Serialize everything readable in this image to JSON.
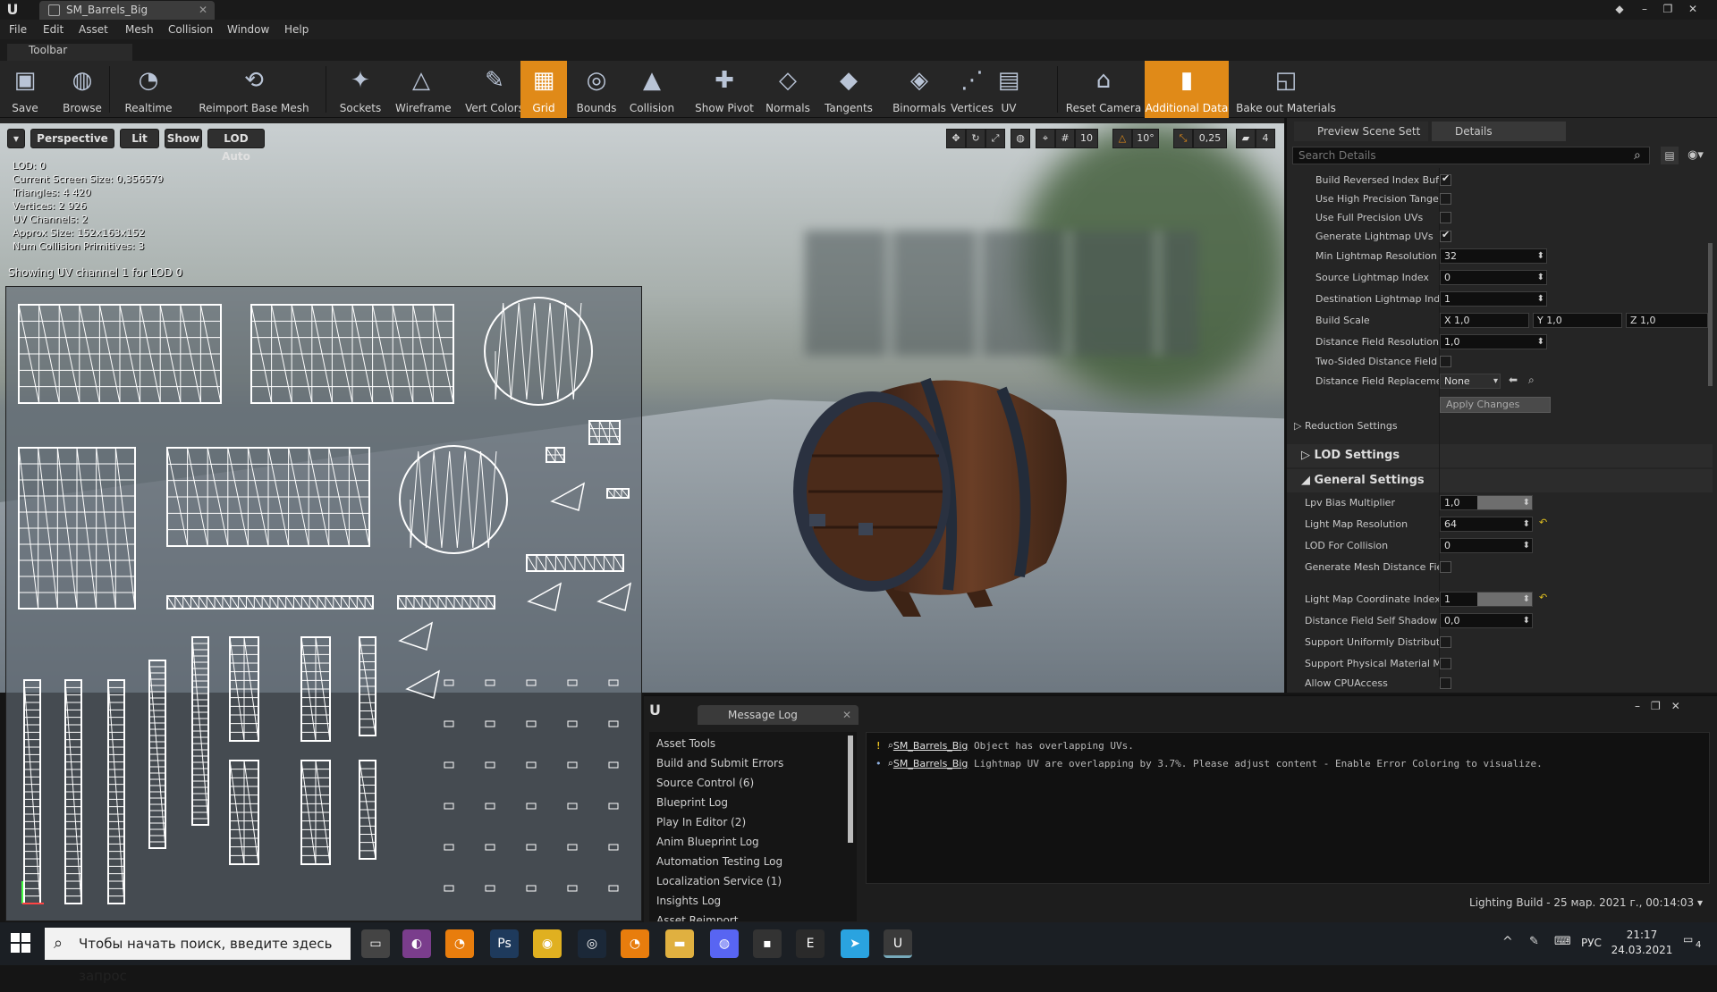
{
  "window": {
    "tab_title": "SM_Barrels_Big"
  },
  "menu": [
    "File",
    "Edit",
    "Asset",
    "Mesh",
    "Collision",
    "Window",
    "Help"
  ],
  "toolbar_panel_label": "Toolbar",
  "toolbar": [
    {
      "label": "Save",
      "icon": "save-icon"
    },
    {
      "label": "Browse",
      "icon": "browse-icon"
    },
    {
      "label": "Realtime",
      "icon": "realtime-icon"
    },
    {
      "label": "Reimport Base Mesh",
      "icon": "reimport-icon"
    },
    {
      "label": "Sockets",
      "icon": "sockets-icon"
    },
    {
      "label": "Wireframe",
      "icon": "wireframe-icon"
    },
    {
      "label": "Vert Colors",
      "icon": "vert-colors-icon"
    },
    {
      "label": "Grid",
      "icon": "grid-icon",
      "active": true
    },
    {
      "label": "Bounds",
      "icon": "bounds-icon"
    },
    {
      "label": "Collision",
      "icon": "collision-icon"
    },
    {
      "label": "Show Pivot",
      "icon": "pivot-icon"
    },
    {
      "label": "Normals",
      "icon": "normals-icon"
    },
    {
      "label": "Tangents",
      "icon": "tangents-icon"
    },
    {
      "label": "Binormals",
      "icon": "binormals-icon"
    },
    {
      "label": "Vertices",
      "icon": "vertices-icon"
    },
    {
      "label": "UV",
      "icon": "uv-icon"
    },
    {
      "label": "Reset Camera",
      "icon": "camera-icon"
    },
    {
      "label": "Additional Data",
      "icon": "additional-data-icon",
      "active": true
    },
    {
      "label": "Bake out Materials",
      "icon": "bake-icon"
    }
  ],
  "viewport": {
    "perspective": "Perspective",
    "lit": "Lit",
    "show": "Show",
    "lod": "LOD Auto",
    "grid_snap": "10",
    "rot_snap": "10°",
    "scale_snap": "0,25",
    "cam_speed": "4",
    "stats": [
      "LOD:  0",
      "Current Screen Size:  0,356579",
      "Triangles:  4 420",
      "Vertices:  2 926",
      "UV Channels:  2",
      "Approx Size: 152x163x152",
      "Num Collision Primitives:  3"
    ],
    "uv_caption": "Showing UV channel 1 for LOD 0"
  },
  "details": {
    "tab_preview": "Preview Scene Sett",
    "tab_details": "Details",
    "search_placeholder": "Search Details",
    "rows": [
      {
        "label": "Build Reversed Index Buffe",
        "type": "check",
        "value": true
      },
      {
        "label": "Use High Precision Tanger",
        "type": "check",
        "value": false
      },
      {
        "label": "Use Full Precision UVs",
        "type": "check",
        "value": false
      },
      {
        "label": "Generate Lightmap UVs",
        "type": "check",
        "value": true
      },
      {
        "label": "Min Lightmap Resolution",
        "type": "num",
        "value": "32"
      },
      {
        "label": "Source Lightmap Index",
        "type": "num",
        "value": "0"
      },
      {
        "label": "Destination Lightmap Inde",
        "type": "num",
        "value": "1"
      },
      {
        "label": "Build Scale",
        "type": "vec",
        "x": "1,0",
        "y": "1,0",
        "z": "1,0"
      },
      {
        "label": "Distance Field Resolution S",
        "type": "num",
        "value": "1,0"
      },
      {
        "label": "Two-Sided Distance Field",
        "type": "check",
        "value": false
      },
      {
        "label": "Distance Field Replacemer",
        "type": "combo",
        "value": "None"
      }
    ],
    "apply_changes": "Apply Changes",
    "reduction_settings": "Reduction Settings",
    "lod_settings": "LOD Settings",
    "general_settings": "General Settings",
    "general_rows": [
      {
        "label": "Lpv Bias Multiplier",
        "type": "slider",
        "value": "1,0"
      },
      {
        "label": "Light Map Resolution",
        "type": "num",
        "value": "64"
      },
      {
        "label": "LOD For Collision",
        "type": "num",
        "value": "0"
      },
      {
        "label": "Generate Mesh Distance Fiel",
        "type": "check",
        "value": false
      },
      {
        "label": "Light Map Coordinate Index",
        "type": "slider",
        "value": "1"
      },
      {
        "label": "Distance Field Self Shadow E",
        "type": "num",
        "value": "0,0"
      },
      {
        "label": "Support Uniformly Distribute",
        "type": "check",
        "value": false
      },
      {
        "label": "Support Physical Material M",
        "type": "check",
        "value": false
      },
      {
        "label": "Allow CPUAccess",
        "type": "check",
        "value": false
      }
    ]
  },
  "message_log": {
    "tab": "Message Log",
    "categories": [
      "Asset Tools",
      "Build and Submit Errors",
      "Source Control (6)",
      "Blueprint Log",
      "Play In Editor (2)",
      "Anim Blueprint Log",
      "Automation Testing Log",
      "Localization Service (1)",
      "Insights Log",
      "Asset Reimport"
    ],
    "lines": [
      {
        "source": "SM_Barrels_Big",
        "text": "Object has overlapping UVs.",
        "severity": "warning"
      },
      {
        "source": "SM_Barrels_Big",
        "text": "Lightmap UV are overlapping by 3.7%. Please adjust content - Enable Error Coloring to visualize.",
        "severity": "info"
      }
    ],
    "filter_label": "Lighting Build - 25 мар. 2021 г., 00:14:03"
  },
  "taskbar": {
    "search_placeholder": "Чтобы начать поиск, введите здесь запрос",
    "lang": "РУС",
    "time": "21:17",
    "date": "24.03.2021",
    "notifications": "4",
    "apps": [
      "task-view-icon",
      "app-icon",
      "blender-icon",
      "photoshop-icon",
      "chrome-icon",
      "steam-icon",
      "blender-icon",
      "explorer-icon",
      "discord-icon",
      "terminal-icon",
      "epic-games-icon",
      "telegram-icon",
      "unreal-icon"
    ]
  },
  "colors": {
    "accent": "#e08a18",
    "panel": "#252525",
    "background": "#151515"
  }
}
